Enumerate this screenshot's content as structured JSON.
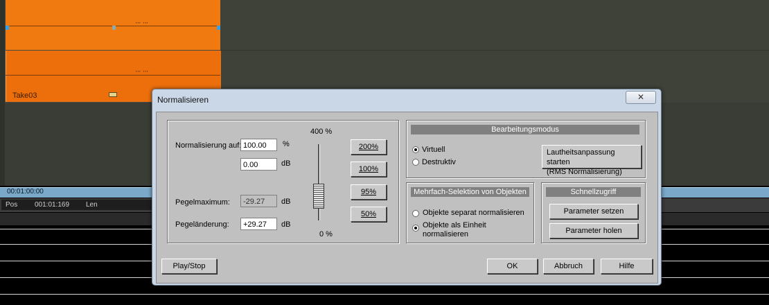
{
  "background": {
    "clip_label": "Take03",
    "timeline_time": "00:01:00:00",
    "pos_label": "Pos",
    "pos_value": "001:01:169",
    "len_label": "Len"
  },
  "dialog": {
    "title": "Normalisieren",
    "close_glyph": "✕",
    "left": {
      "normalize_label": "Normalisierung auf:",
      "percent_value": "100.00",
      "percent_unit": "%",
      "db_value": "0.00",
      "db_unit": "dB",
      "peak_label": "Pegelmaximum:",
      "peak_value": "-29.27",
      "peak_unit": "dB",
      "change_label": "Pegeländerung:",
      "change_value": "+29.27",
      "change_unit": "dB",
      "slider_top_label": "400 %",
      "slider_bottom_label": "0 %",
      "slider_level_percent": 100,
      "preset_buttons": [
        "200%",
        "100%",
        "95%",
        "50%"
      ]
    },
    "mode": {
      "header": "Bearbeitungsmodus",
      "options": [
        "Virtuell",
        "Destruktiv"
      ],
      "selected": "Virtuell",
      "rms_button_line1": "Lautheitsanpassung starten",
      "rms_button_line2": "(RMS Normalisierung)"
    },
    "multi": {
      "header": "Mehrfach-Selektion von Objekten",
      "option1": "Objekte separat normalisieren",
      "option2_line1": "Objekte als Einheit",
      "option2_line2": "normalisieren",
      "selected": "option2"
    },
    "quick": {
      "header": "Schnellzugriff",
      "set_button": "Parameter setzen",
      "get_button": "Parameter holen"
    },
    "footer": {
      "play_button": "Play/Stop",
      "ok_button": "OK",
      "cancel_button": "Abbruch",
      "help_button": "Hilfe"
    }
  }
}
